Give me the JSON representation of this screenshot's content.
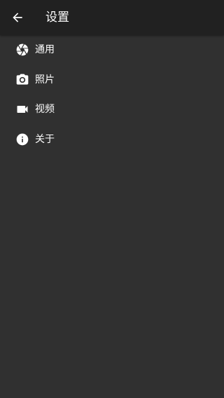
{
  "app_bar": {
    "title": "设置",
    "back_icon": "arrow-back-icon"
  },
  "settings": {
    "items": [
      {
        "label": "通用",
        "icon": "aperture-icon"
      },
      {
        "label": "照片",
        "icon": "camera-icon"
      },
      {
        "label": "视频",
        "icon": "videocam-icon"
      },
      {
        "label": "关于",
        "icon": "info-icon"
      }
    ]
  },
  "colors": {
    "background": "#303030",
    "app_bar": "#212121",
    "text": "#ffffff"
  }
}
